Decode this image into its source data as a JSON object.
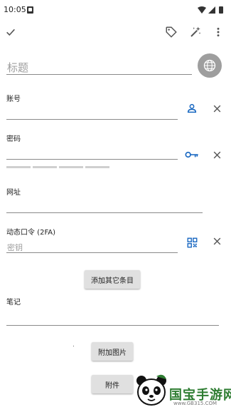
{
  "status_bar": {
    "time": "10:05"
  },
  "form": {
    "title_placeholder": "标题",
    "account_label": "账号",
    "password_label": "密码",
    "url_label": "网址",
    "totp_label": "动态口令 (2FA)",
    "totp_key_placeholder": "密钥",
    "notes_label": "笔记"
  },
  "buttons": {
    "add_other": "添加其它条目",
    "attach_image": "附加图片",
    "attachment": "附件"
  },
  "watermark": {
    "title": "国宝手游网",
    "url": "www.GB315.COM"
  },
  "icons": {
    "save": "check-icon",
    "tag": "tag-icon",
    "generate": "magic-wand-icon",
    "menu": "more-vertical-icon",
    "website": "globe-icon",
    "user": "person-icon",
    "password": "key-icon",
    "scan": "qr-code-icon",
    "clear": "close-icon"
  },
  "colors": {
    "accent": "#1565c0",
    "icon_gray": "#555555"
  }
}
